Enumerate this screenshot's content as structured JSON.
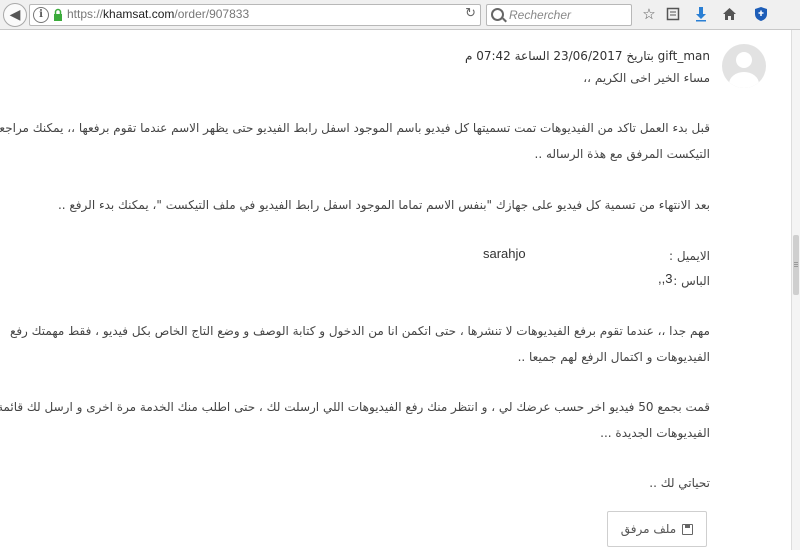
{
  "browser": {
    "url_prefix": "https://",
    "url_domain": "khamsat.com",
    "url_path": "/order/907833",
    "search_placeholder": "Rechercher"
  },
  "message": {
    "username": "gift_man",
    "meta": "بتاريخ 23/06/2017 الساعة 07:42 م",
    "greeting": "مساء الخير اخى الكريم ،،",
    "para1_line1": "قبل بدء العمل تاكد من الفيديوهات تمت تسميتها كل فيديو باسم الموجود اسفل رابط الفيديو حتى يظهر الاسم عندما تقوم برفعها ،، يمكنك مراجعة ملف",
    "para1_line2": "التيكست المرفق مع هذة الرساله ..",
    "para2": "بعد الانتهاء من تسمية كل فيديو على جهازك \"بنفس الاسم تماما الموجود اسفل رابط الفيديو في ملف التيكست \"، يمكنك بدء الرفع ..",
    "email_label": "الايميل :",
    "email_value": "sarahjo",
    "pass_label": "الباس :",
    "pass_value": ",,3",
    "para3_line1": "مهم جدا ،، عندما تقوم برفع الفيديوهات لا تنشرها ، حتى اتكمن انا من الدخول و كتابة الوصف و وضع التاج الخاص بكل فيديو ، فقط مهمتك رفع",
    "para3_line2": "الفيديوهات و اكتمال الرفع لهم جميعا ..",
    "para4_line1": "قمت بجمع 50 فيديو اخر حسب عرضك لي ، و انتظر منك رفع الفيديوهات اللي ارسلت لك ، حتى اطلب منك الخدمة مرة اخرى و ارسل لك قائمة",
    "para4_line2": "الفيديوهات الجديدة ...",
    "closing": "تحياتي لك ..",
    "attachment_label": "ملف مرفق"
  }
}
